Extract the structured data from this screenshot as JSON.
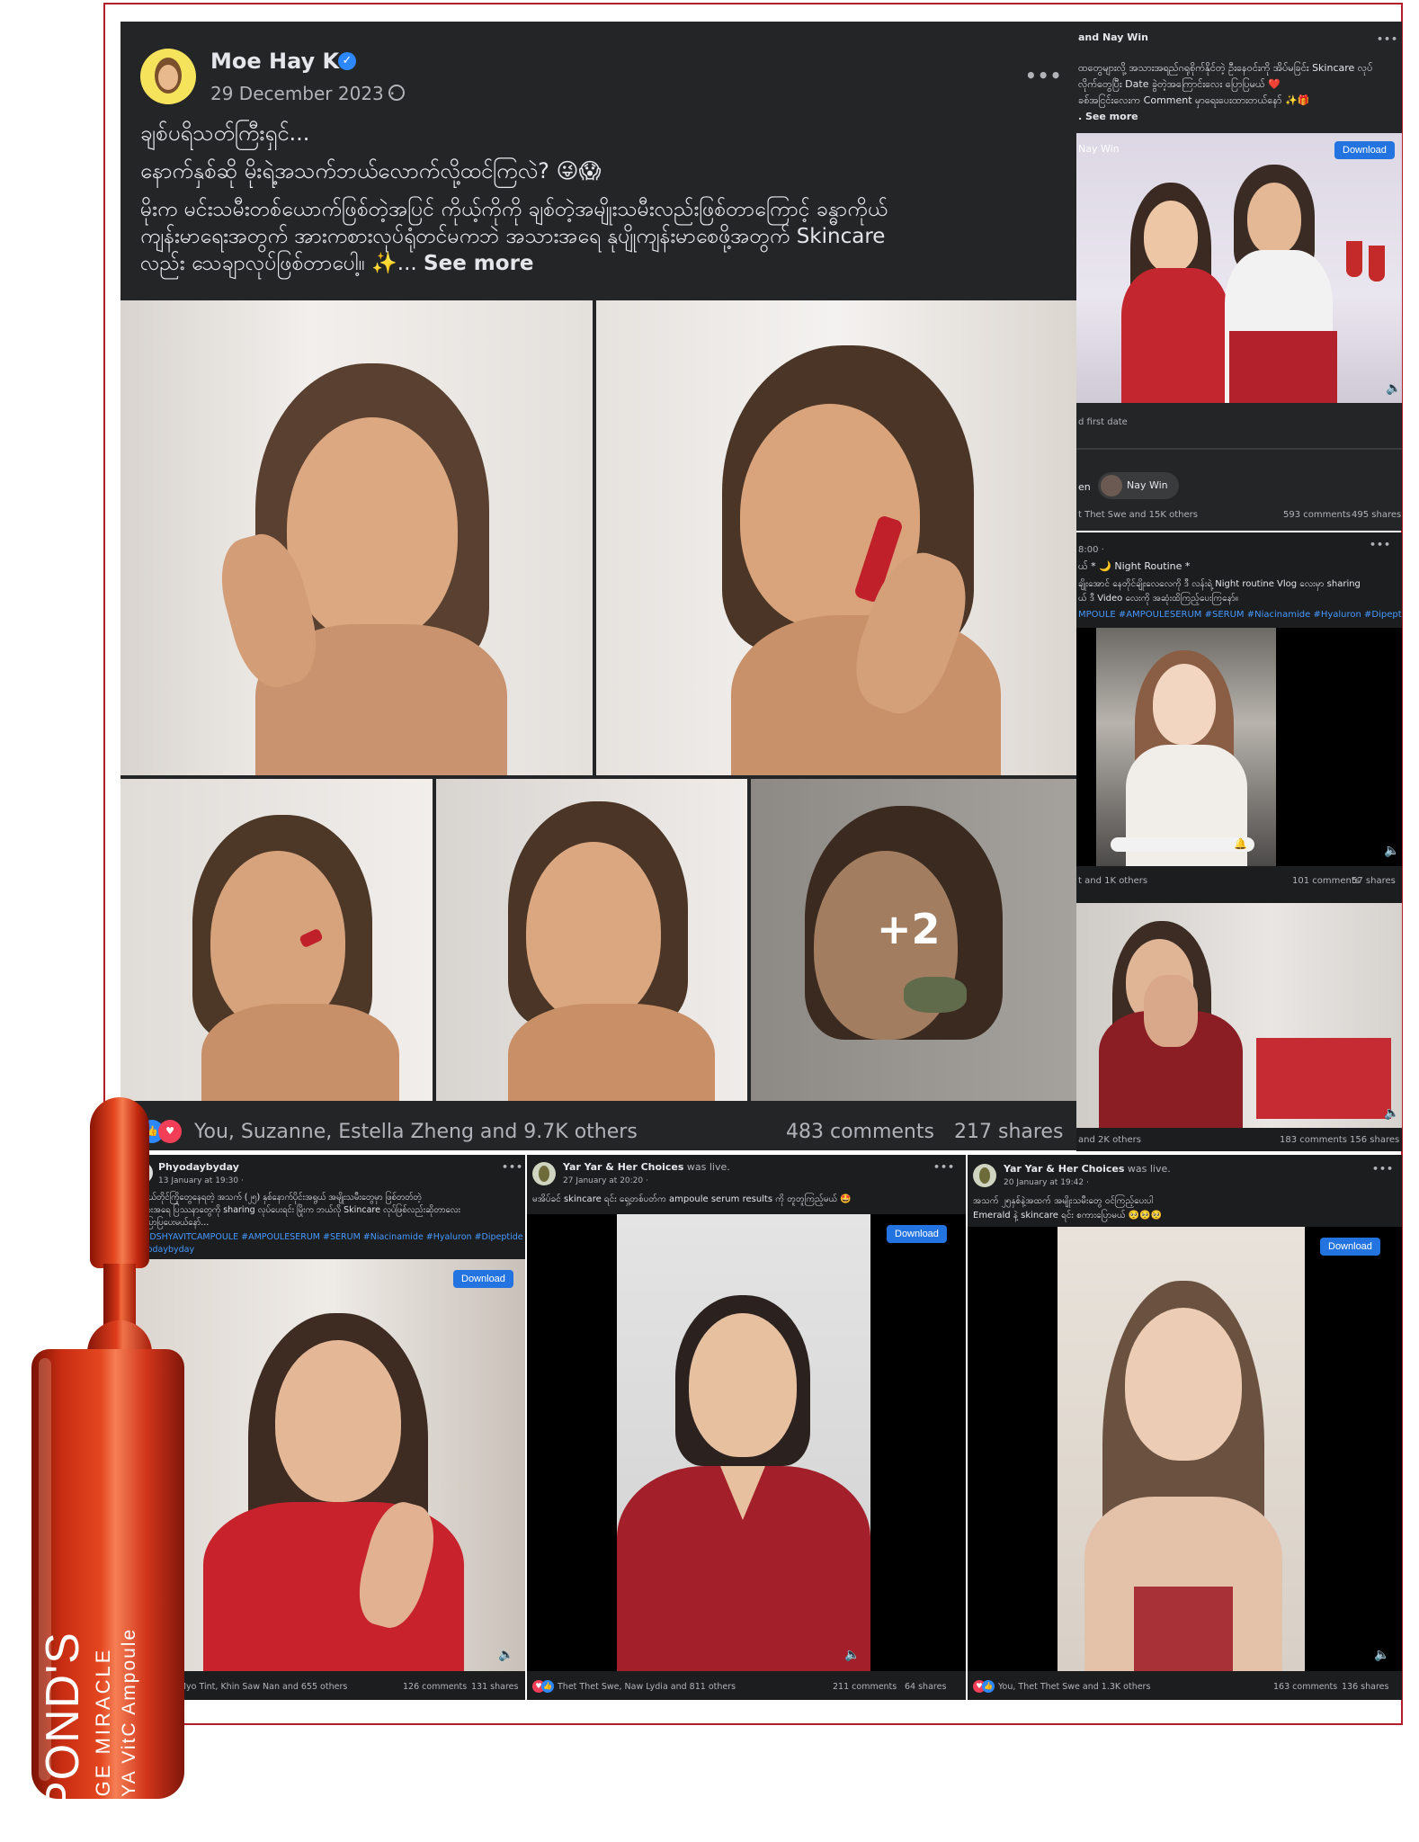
{
  "main_post": {
    "author": "Moe Hay Ko",
    "date": "29 December 2023 ·",
    "line1": "ချစ်ပရိသတ်ကြီးရှင်...",
    "line2": "နောက်နှစ်ဆို မိုးရဲ့အသက်ဘယ်လောက်လို့ထင်ကြလဲ? 😜😱",
    "line3": "မိုးက မင်းသမီးတစ်ယောက်ဖြစ်တဲ့အပြင် ကိုယ့်ကိုကို ချစ်တဲ့အမျိုးသမီးလည်းဖြစ်တာကြောင့် ခန္ဓာကိုယ်",
    "line4": "ကျန်းမာရေးအတွက် အားကစားလုပ်ရုံတင်မကဘဲ အသားအရေ နုပျိုကျန်းမာစေဖို့အတွက် Skincare",
    "line5": "လည်း သေချာလုပ်ဖြစ်တာပေါ့။ ✨...",
    "see_more": "See more",
    "more_photos": "+2",
    "reactions": "You, Suzanne, Estella Zheng and 9.7K others",
    "comments": "483 comments",
    "shares": "217 shares",
    "menu": "•••"
  },
  "right_top": {
    "header": "and Nay Win",
    "text1": "ထတွေများလို့ အသားအရည်ဂရုစိုက်နိုင်တဲ့ ဦးနေဝင်းကို အိပ်မခြင်း Skincare လုပ်",
    "text2": "လိုက်တွေပြီး Date ခွဲတဲ့အကြောင်းလေး ပြောပြမယ် ❤️",
    "text3": "ခစ်အငြင်းလေးက Comment မှာရေးပေးထားတယ်နော် ✨🎁",
    "see_more": ". See more",
    "video_tag": "Nay Win",
    "download": "Download",
    "caption": "d first date",
    "tag_left": "en",
    "tag_name": "Nay Win",
    "reactions": "t Thet Swe and 15K others",
    "comments": "593 comments",
    "shares": "495 shares",
    "menu": "•••"
  },
  "right_mid": {
    "time": "8:00 ·",
    "title": "ယ် * 🌙 Night Routine *",
    "text": "ချိုးအောင် နေတိုင်ချိုးလေလေကို ဒီ လန်းရဲ့ Night routine Vlog လေးမှာ sharing",
    "text2": "ယ် ဒီ Video လေးကို အဆုံးထိကြည့်ပေးကြနော်။",
    "tags": "MPOULE #AMPOULESERUM #SERUM #Niacinamide #Hyaluron #Dipeptide",
    "reactions": "t and 1K others",
    "comments": "101 comments",
    "shares": "57 shares",
    "menu": "•••"
  },
  "right_low": {
    "reactions": "and 2K others",
    "comments": "183 comments",
    "shares": "156 shares"
  },
  "post_a": {
    "author": "Phyodaybyday",
    "date": "13 January at 19:30 ·",
    "text1": "မြိုးကိုယ်တိုင်ကြိုတွေနေရတဲ့ အသက် (၂၅) နှစ်နောက်ပိုင်းအရွယ် အမျိုးသမီးတွေမှာ ဖြစ်တတ်တဲ့",
    "text2": "အသားအရေ ပြဿနာတွေကို sharing လုပ်ပေးရင်း မြိုးက ဘယ်လို Skincare လုပ်ဖြစ်လည်းဆိုတာလေး",
    "text3": "ကို ပြောပြပေးမယ်နော်...",
    "tags": "PONDSHYAVITCAMPOULE #AMPOULESERUM #SERUM #Niacinamide #Hyaluron #Dipeptide",
    "tag2": "phyodaybyday",
    "download": "Download",
    "reactions": "Thu Myo Tint, Khin Saw Nan and 655 others",
    "comments": "126 comments",
    "shares": "131 shares",
    "menu": "•••"
  },
  "post_b": {
    "author": "Yar Yar & Her Choices",
    "was_live": "was live.",
    "date": "27 January at 20:20 ·",
    "text": "မအိပ်ခင် skincare ရင်း ရှေ့တစ်ပတ်က ampoule serum results ကို တူတူကြည့်မယ် 🤩",
    "download": "Download",
    "reactions": "Thet Thet Swe, Naw Lydia and 811 others",
    "comments": "211 comments",
    "shares": "64 shares",
    "menu": "•••"
  },
  "post_c": {
    "author": "Yar Yar & Her Choices",
    "was_live": "was live.",
    "date": "20 January at 19:42 ·",
    "text1": "အသက် ၂၅နှစ်နဲ့အထက် အမျိုးသမီးတွေ ဝင်ကြည့်ပေးပါ",
    "text2": "Emerald နဲ့ skincare ရင်း စကားပြောမယ် 🥺🥺🥺",
    "download": "Download",
    "reactions": "You, Thet Thet Swe and 1.3K others",
    "comments": "163 comments",
    "shares": "136 shares",
    "menu": "•••"
  },
  "product": {
    "brand": "POND'S",
    "line1": "AGE MIRACLE",
    "line2": "HYA VitC Ampoule"
  },
  "colors": {
    "fb_dark": "#242526",
    "frame_red": "#b21e2a",
    "ampoule_red": "#d9331a",
    "link_blue": "#4599ff"
  }
}
